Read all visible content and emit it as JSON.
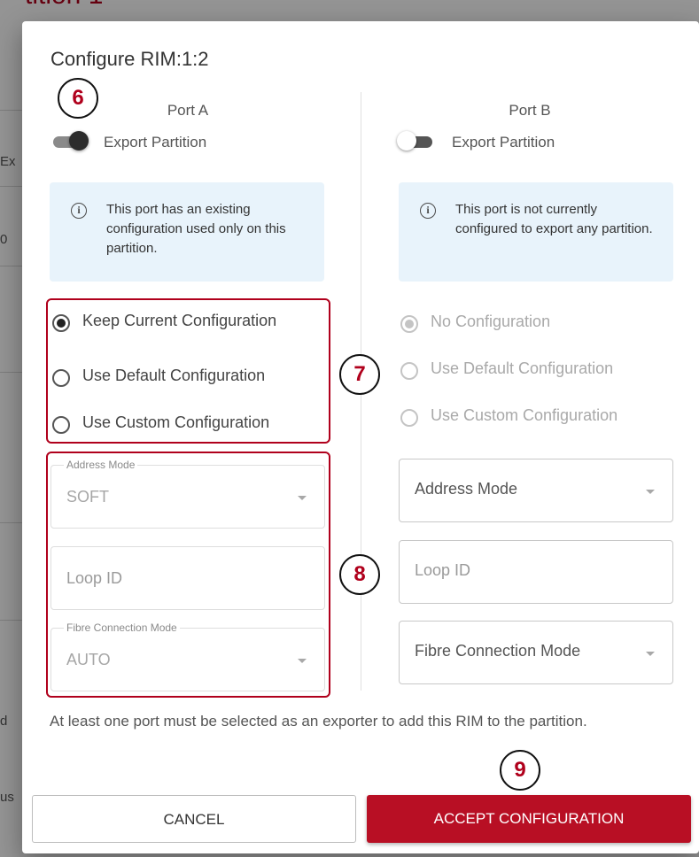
{
  "background": {
    "title": "tition 1",
    "fragments": [
      "Ex",
      "0",
      "d",
      "us"
    ]
  },
  "dialog": {
    "title": "Configure RIM:1:2",
    "port_a": {
      "name": "Port A",
      "export_label": "Export Partition",
      "export_enabled": true,
      "info": "This port has an existing configuration used only on this partition.",
      "options": [
        {
          "label": "Keep Current Configuration",
          "checked": true
        },
        {
          "label": "Use Default Configuration",
          "checked": false
        },
        {
          "label": "Use Custom Configuration",
          "checked": false
        }
      ],
      "address_mode": {
        "label": "Address Mode",
        "value": "SOFT"
      },
      "loop_id": {
        "placeholder": "Loop ID"
      },
      "fibre_mode": {
        "label": "Fibre Connection Mode",
        "value": "AUTO"
      }
    },
    "port_b": {
      "name": "Port B",
      "export_label": "Export Partition",
      "export_enabled": false,
      "info": "This port is not currently configured to export any partition.",
      "options": [
        {
          "label": "No Configuration",
          "checked": true
        },
        {
          "label": "Use Default Configuration",
          "checked": false
        },
        {
          "label": "Use Custom Configuration",
          "checked": false
        }
      ],
      "address_mode": {
        "placeholder": "Address Mode"
      },
      "loop_id": {
        "placeholder": "Loop ID"
      },
      "fibre_mode": {
        "placeholder": "Fibre Connection Mode"
      }
    },
    "note": "At least one port must be selected as an exporter to add this RIM to the partition.",
    "cancel_label": "CANCEL",
    "accept_label": "ACCEPT CONFIGURATION"
  },
  "callouts": [
    "6",
    "7",
    "8",
    "9"
  ],
  "colors": {
    "accent": "#b80f24",
    "info_bg": "#e8f3fb",
    "callout_text": "#b0001c"
  }
}
